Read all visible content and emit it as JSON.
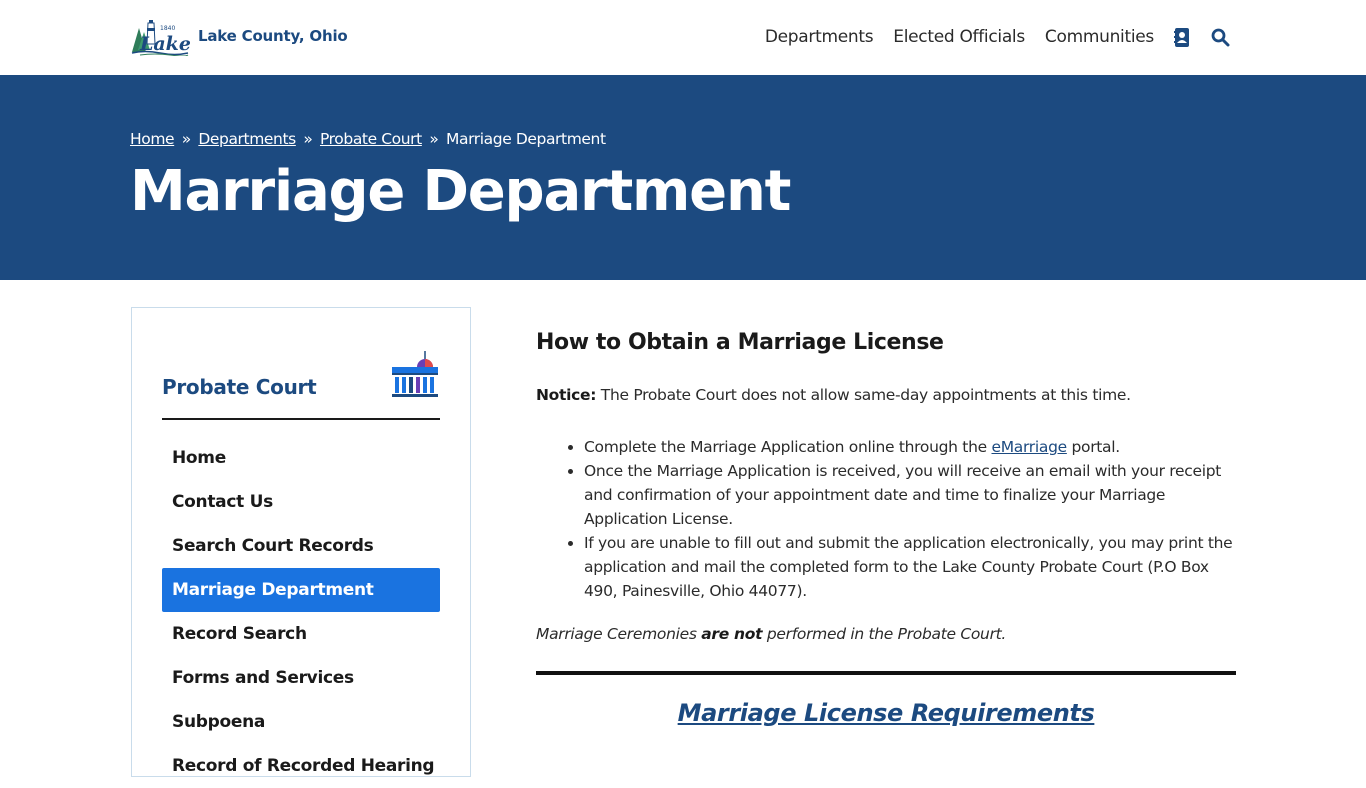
{
  "header": {
    "site_name": "Lake County, Ohio",
    "logo_text": "Lake",
    "logo_year": "1840",
    "nav": [
      {
        "label": "Departments"
      },
      {
        "label": "Elected Officials"
      },
      {
        "label": "Communities"
      }
    ],
    "icons": {
      "contacts": "address-book-icon",
      "search": "search-icon"
    }
  },
  "banner": {
    "breadcrumb": {
      "home": "Home",
      "departments": "Departments",
      "probate": "Probate Court",
      "current": "Marriage Department",
      "separator": "»"
    },
    "title": "Marriage Department"
  },
  "sidebar": {
    "title": "Probate Court",
    "icon": "courthouse-icon",
    "items": [
      {
        "label": "Home"
      },
      {
        "label": "Contact Us"
      },
      {
        "label": "Search Court Records"
      },
      {
        "label": "Marriage Department"
      },
      {
        "label": "Record Search"
      },
      {
        "label": "Forms and Services"
      },
      {
        "label": "Subpoena"
      },
      {
        "label": "Record of Recorded Hearing"
      }
    ],
    "active_index": 3
  },
  "content": {
    "heading": "How to Obtain a Marriage License",
    "notice_label": "Notice:",
    "notice_text": " The Probate Court does not allow same-day appointments at this time.",
    "bullet1_pre": "Complete the Marriage Application online through the ",
    "bullet1_link": "eMarriage",
    "bullet1_post": " portal.",
    "bullet2": "Once the Marriage Application is received, you will receive an email with your receipt and confirmation of your appointment date and time to finalize your Marriage Application License.",
    "bullet3": "If you are unable to fill out and submit the application electronically, you may print the application and mail the completed form to the Lake County Probate Court (P.O Box 490, Painesville, Ohio 44077).",
    "ceremony_pre": "Marriage Ceremonies ",
    "ceremony_bold": "are not",
    "ceremony_post": " performed in the Probate Court.",
    "requirements_link": "Marriage License Requirements"
  },
  "colors": {
    "brand_blue": "#1c4a80",
    "active_blue": "#1a73e0",
    "sidebar_border": "#c9dceb"
  }
}
